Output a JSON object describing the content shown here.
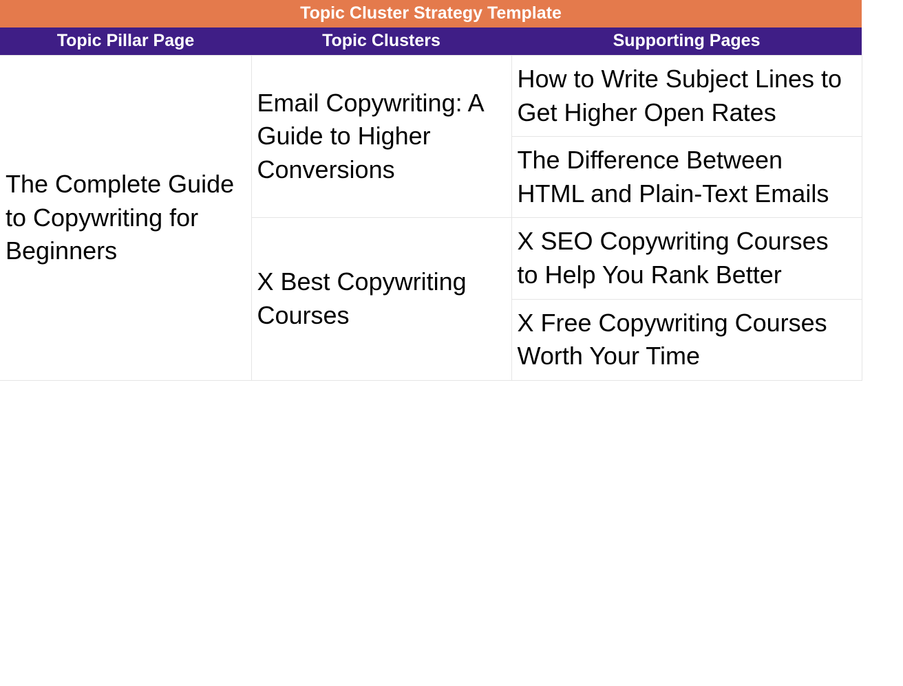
{
  "title": "Topic Cluster Strategy Template",
  "headers": {
    "pillar": "Topic Pillar Page",
    "clusters": "Topic Clusters",
    "supporting": "Supporting Pages"
  },
  "pillar": "The Complete Guide to Copywriting for Beginners",
  "clusters": [
    {
      "name": "Email Copywriting: A Guide to Higher Conversions",
      "supporting": [
        "How to Write Subject Lines to Get Higher Open Rates",
        "The Difference Between HTML and Plain-Text Emails"
      ]
    },
    {
      "name": "X Best Copywriting Courses",
      "supporting": [
        "X SEO Copywriting Courses to Help You Rank Better",
        "X Free Copywriting Courses Worth Your Time"
      ]
    }
  ]
}
